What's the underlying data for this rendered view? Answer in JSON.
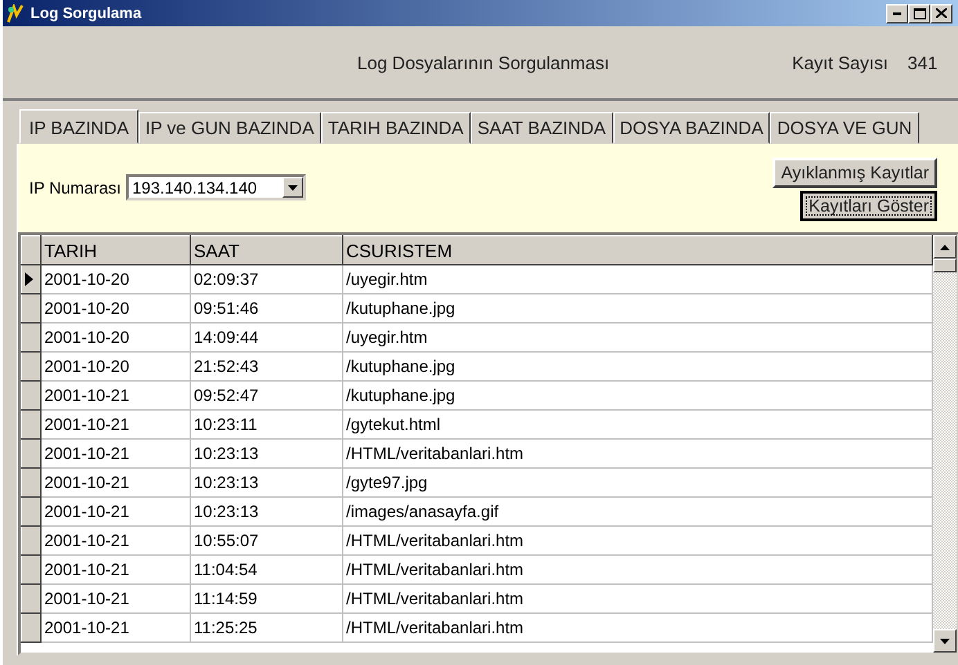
{
  "window": {
    "title": "Log Sorgulama"
  },
  "header": {
    "title": "Log Dosyalarının Sorgulanması",
    "count_label": "Kayıt Sayısı",
    "count_value": "341"
  },
  "tabs": [
    {
      "label": "IP BAZINDA",
      "selected": true
    },
    {
      "label": "IP ve GUN BAZINDA",
      "selected": false
    },
    {
      "label": "TARIH BAZINDA",
      "selected": false
    },
    {
      "label": "SAAT BAZINDA",
      "selected": false
    },
    {
      "label": "DOSYA BAZINDA",
      "selected": false
    },
    {
      "label": "DOSYA VE GUN",
      "selected": false
    }
  ],
  "filter": {
    "label": "IP Numarası",
    "value": "193.140.134.140"
  },
  "buttons": [
    {
      "label": "Ayıklanmış Kayıtlar",
      "focused": false
    },
    {
      "label": "Kayıtları Göster",
      "focused": true
    }
  ],
  "table": {
    "columns": [
      "TARIH",
      "SAAT",
      "CSURISTEM"
    ],
    "rows": [
      {
        "cells": [
          "2001-10-20",
          "02:09:37",
          "/uyegir.htm"
        ],
        "selected": true
      },
      {
        "cells": [
          "2001-10-20",
          "09:51:46",
          "/kutuphane.jpg"
        ],
        "selected": false
      },
      {
        "cells": [
          "2001-10-20",
          "14:09:44",
          "/uyegir.htm"
        ],
        "selected": false
      },
      {
        "cells": [
          "2001-10-20",
          "21:52:43",
          "/kutuphane.jpg"
        ],
        "selected": false
      },
      {
        "cells": [
          "2001-10-21",
          "09:52:47",
          "/kutuphane.jpg"
        ],
        "selected": false
      },
      {
        "cells": [
          "2001-10-21",
          "10:23:11",
          "/gytekut.html"
        ],
        "selected": false
      },
      {
        "cells": [
          "2001-10-21",
          "10:23:13",
          "/HTML/veritabanlari.htm"
        ],
        "selected": false
      },
      {
        "cells": [
          "2001-10-21",
          "10:23:13",
          "/gyte97.jpg"
        ],
        "selected": false
      },
      {
        "cells": [
          "2001-10-21",
          "10:23:13",
          "/images/anasayfa.gif"
        ],
        "selected": false
      },
      {
        "cells": [
          "2001-10-21",
          "10:55:07",
          "/HTML/veritabanlari.htm"
        ],
        "selected": false
      },
      {
        "cells": [
          "2001-10-21",
          "11:04:54",
          "/HTML/veritabanlari.htm"
        ],
        "selected": false
      },
      {
        "cells": [
          "2001-10-21",
          "11:14:59",
          "/HTML/veritabanlari.htm"
        ],
        "selected": false
      },
      {
        "cells": [
          "2001-10-21",
          "11:25:25",
          "/HTML/veritabanlari.htm"
        ],
        "selected": false
      }
    ]
  }
}
